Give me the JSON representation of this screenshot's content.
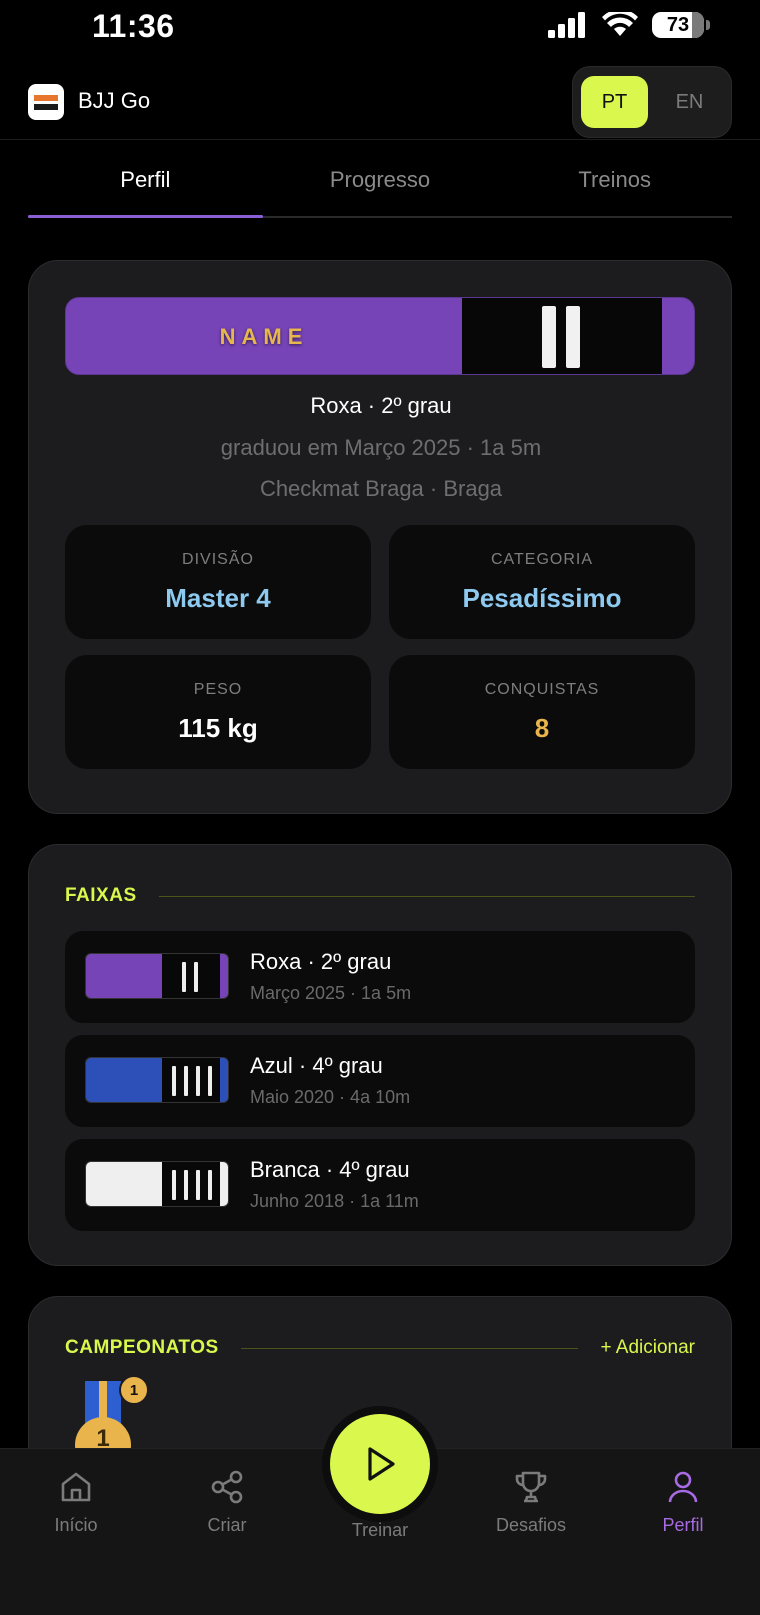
{
  "status": {
    "time": "11:36",
    "battery": "73"
  },
  "header": {
    "app_title": "BJJ Go",
    "lang_active": "PT",
    "lang_inactive": "EN"
  },
  "tabs": [
    {
      "label": "Perfil"
    },
    {
      "label": "Progresso"
    },
    {
      "label": "Treinos"
    }
  ],
  "profile": {
    "name": "NAME",
    "belt_color": "#7744b8",
    "belt_title": "Roxa · 2º grau",
    "graduated": "graduou em Março 2025 · 1a 5m",
    "academy": "Checkmat Braga · Braga",
    "stats": [
      {
        "label": "DIVISÃO",
        "value": "Master 4"
      },
      {
        "label": "CATEGORIA",
        "value": "Pesadíssimo"
      },
      {
        "label": "PESO",
        "value": "115 kg"
      },
      {
        "label": "CONQUISTAS",
        "value": "8"
      }
    ]
  },
  "faixas": {
    "title": "FAIXAS",
    "items": [
      {
        "title": "Roxa · 2º grau",
        "subtitle": "Março 2025 · 1a 5m",
        "color": "#7744b8",
        "stripes": 2
      },
      {
        "title": "Azul · 4º grau",
        "subtitle": "Maio 2020 · 4a 10m",
        "color": "#2d4fb8",
        "stripes": 4
      },
      {
        "title": "Branca · 4º grau",
        "subtitle": "Junho 2018 · 1a 11m",
        "color": "#efefef",
        "stripes": 4
      }
    ]
  },
  "campeonatos": {
    "title": "CAMPEONATOS",
    "action": "+ Adicionar",
    "medal_number": "1",
    "medal_count": "1"
  },
  "nav": {
    "home": "Início",
    "create": "Criar",
    "train": "Treinar",
    "challenges": "Desafios",
    "profile": "Perfil"
  },
  "colors": {
    "accent": "#d9f74c",
    "purple": "#a86be3",
    "gold": "#e9b44c",
    "blue_value": "#8ec9ef"
  }
}
